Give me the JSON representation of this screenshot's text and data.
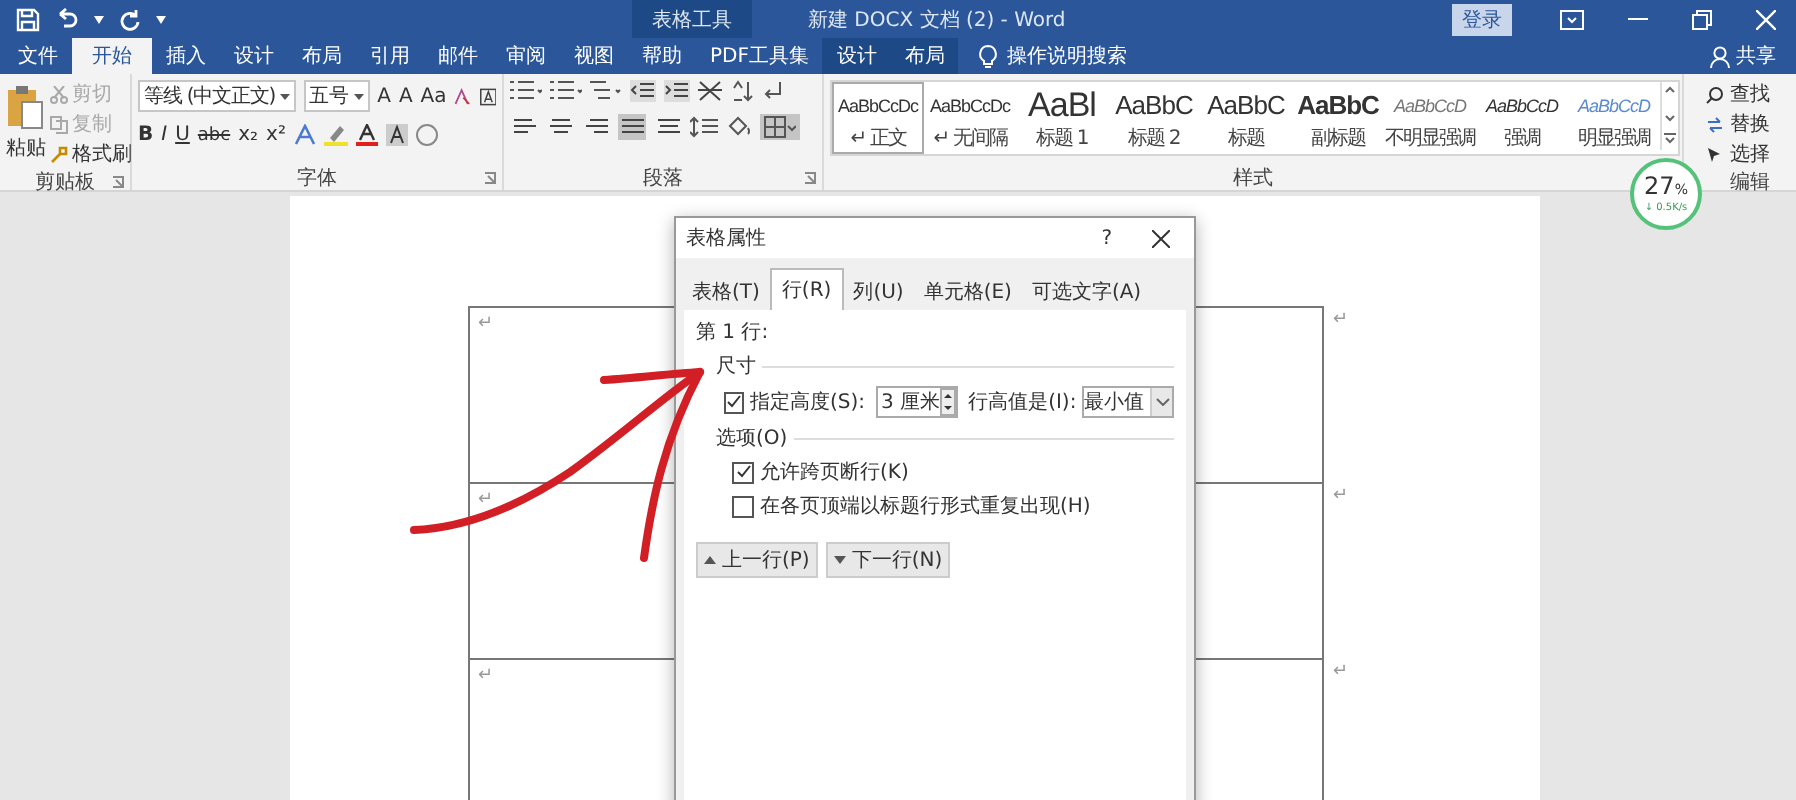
{
  "window": {
    "context_header": "表格工具",
    "title": "新建 DOCX 文档 (2)  -  Word",
    "login": "登录"
  },
  "tabs": [
    {
      "label": "文件",
      "selected": false,
      "contextual": false
    },
    {
      "label": "开始",
      "selected": true,
      "contextual": false
    },
    {
      "label": "插入",
      "selected": false,
      "contextual": false
    },
    {
      "label": "设计",
      "selected": false,
      "contextual": false
    },
    {
      "label": "布局",
      "selected": false,
      "contextual": false
    },
    {
      "label": "引用",
      "selected": false,
      "contextual": false
    },
    {
      "label": "邮件",
      "selected": false,
      "contextual": false
    },
    {
      "label": "审阅",
      "selected": false,
      "contextual": false
    },
    {
      "label": "视图",
      "selected": false,
      "contextual": false
    },
    {
      "label": "帮助",
      "selected": false,
      "contextual": false
    },
    {
      "label": "PDF工具集",
      "selected": false,
      "contextual": false
    },
    {
      "label": "设计",
      "selected": false,
      "contextual": true
    },
    {
      "label": "布局",
      "selected": false,
      "contextual": true
    }
  ],
  "tell_me": "操作说明搜索",
  "share": "共享",
  "clipboard": {
    "label": "剪贴板",
    "paste": "粘贴",
    "items": [
      {
        "label": "剪切",
        "disabled": true
      },
      {
        "label": "复制",
        "disabled": true
      },
      {
        "label": "格式刷",
        "disabled": false
      }
    ]
  },
  "font": {
    "label": "字体",
    "family": "等线 (中文正文)",
    "size": "五号",
    "row1": [
      "A",
      "A",
      "Aa"
    ],
    "row2": [
      "B",
      "I",
      "U",
      "abc",
      "x₂",
      "x²"
    ]
  },
  "paragraph": {
    "label": "段落",
    "alignments": [
      {
        "selected": false
      },
      {
        "selected": false
      },
      {
        "selected": false
      },
      {
        "selected": true
      },
      {
        "selected": false
      }
    ],
    "borders_selected": true
  },
  "styles": {
    "label": "样式",
    "items": [
      {
        "preview": "AaBbCcDc",
        "name": "↵ 正文",
        "kind": "normal",
        "selected": true
      },
      {
        "preview": "AaBbCcDc",
        "name": "↵ 无间隔",
        "kind": "normal",
        "selected": false
      },
      {
        "preview": "AaBl",
        "name": "标题 1",
        "kind": "big",
        "selected": false
      },
      {
        "preview": "AaBbC",
        "name": "标题 2",
        "kind": "medium",
        "selected": false
      },
      {
        "preview": "AaBbC",
        "name": "标题",
        "kind": "medium",
        "selected": false
      },
      {
        "preview": "AaBbC",
        "name": "副标题",
        "kind": "bold",
        "selected": false
      },
      {
        "preview": "AaBbCcD",
        "name": "不明显强调",
        "kind": "faint",
        "selected": false
      },
      {
        "preview": "AaBbCcD",
        "name": "强调",
        "kind": "italic",
        "selected": false
      },
      {
        "preview": "AaBbCcD",
        "name": "明显强调",
        "kind": "accent",
        "selected": false
      }
    ]
  },
  "editing": {
    "label": "编辑",
    "items": [
      "查找",
      "替换",
      "选择"
    ]
  },
  "speed_widget": {
    "percent": "27",
    "unit": "%",
    "rate": "↓ 0.5K/s"
  },
  "document": {
    "rows": [
      {
        "mark": "↵",
        "end_mark": "↵"
      },
      {
        "mark": "↵",
        "end_mark": "↵"
      },
      {
        "mark": "↵",
        "end_mark": "↵"
      }
    ]
  },
  "dialog": {
    "title": "表格属性",
    "help": "?",
    "tabs": [
      {
        "label": "表格(T)",
        "selected": false
      },
      {
        "label": "行(R)",
        "selected": true
      },
      {
        "label": "列(U)",
        "selected": false
      },
      {
        "label": "单元格(E)",
        "selected": false
      },
      {
        "label": "可选文字(A)",
        "selected": false
      }
    ],
    "row_heading": "第 1 行:",
    "size_section": "尺寸",
    "height_check": {
      "label": "指定高度(S):",
      "checked": true
    },
    "height_value": "3 厘米",
    "height_rule_label": "行高值是(I):",
    "height_rule": "最小值",
    "options_section": "选项(O)",
    "options": [
      {
        "label": "允许跨页断行(K)",
        "checked": true
      },
      {
        "label": "在各页顶端以标题行形式重复出现(H)",
        "checked": false
      }
    ],
    "prev_row": "上一行(P)",
    "next_row": "下一行(N)"
  }
}
